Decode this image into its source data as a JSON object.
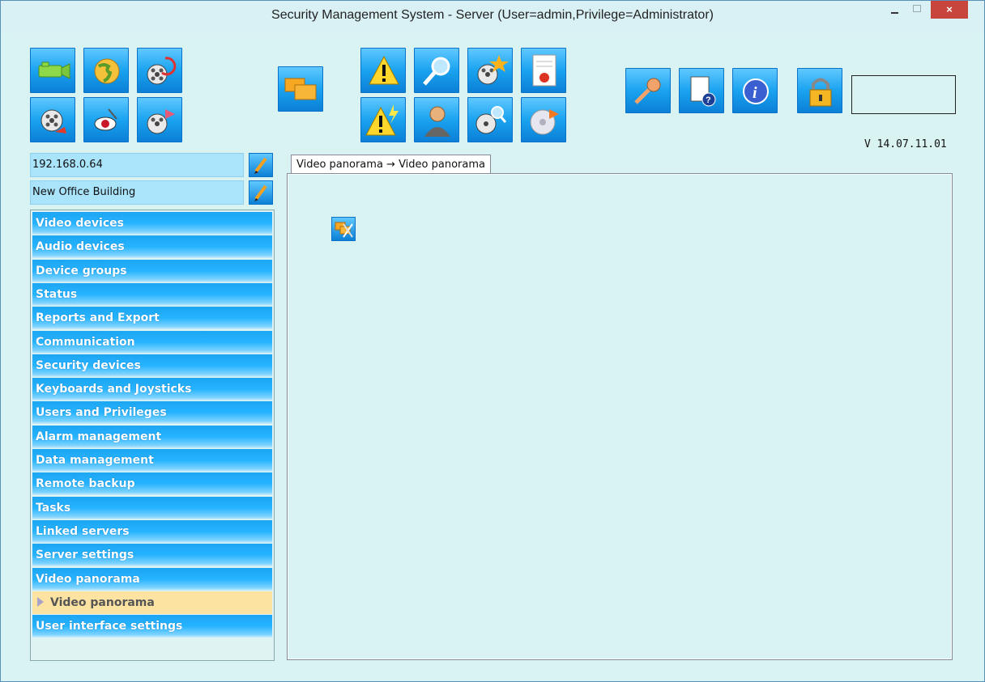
{
  "window": {
    "title": "Security Management System - Server (User=admin,Privilege=Administrator)",
    "close_glyph": "×"
  },
  "toolbar": {
    "group1": [
      "camera-icon",
      "globe-icon",
      "film-refresh-icon",
      "film-brush-icon",
      "eye-pin-icon",
      "film-export-icon"
    ],
    "group2": [
      "windows-layout-icon"
    ],
    "group3": [
      "alarm-warning-icon",
      "search-icon",
      "film-star-icon",
      "report-icon",
      "alarm-flash-icon",
      "user-icon",
      "film-search-icon",
      "disc-export-icon"
    ],
    "group4": [
      "key-icon",
      "help-document-icon",
      "info-icon",
      "lock-icon"
    ]
  },
  "password_field": {
    "value": ""
  },
  "version": "V 14.07.11.01",
  "server": {
    "ip": "192.168.0.64",
    "site": "New Office Building"
  },
  "nav": {
    "items": [
      "Video devices",
      "Audio devices",
      "Device groups",
      "Status",
      "Reports and Export",
      "Communication",
      "Security devices",
      "Keyboards and Joysticks",
      "Users and Privileges",
      "Alarm management",
      "Data management",
      "Remote backup",
      "Tasks",
      "Linked servers",
      "Server settings",
      "Video panorama",
      "Video panorama",
      "User interface settings"
    ],
    "selected_index": 16
  },
  "tab": {
    "label": "Video panorama → Video panorama"
  },
  "colors": {
    "accent": "#1ca5f2",
    "selected": "#fde3a1",
    "close": "#c7453d",
    "background": "#d9f3f3"
  }
}
